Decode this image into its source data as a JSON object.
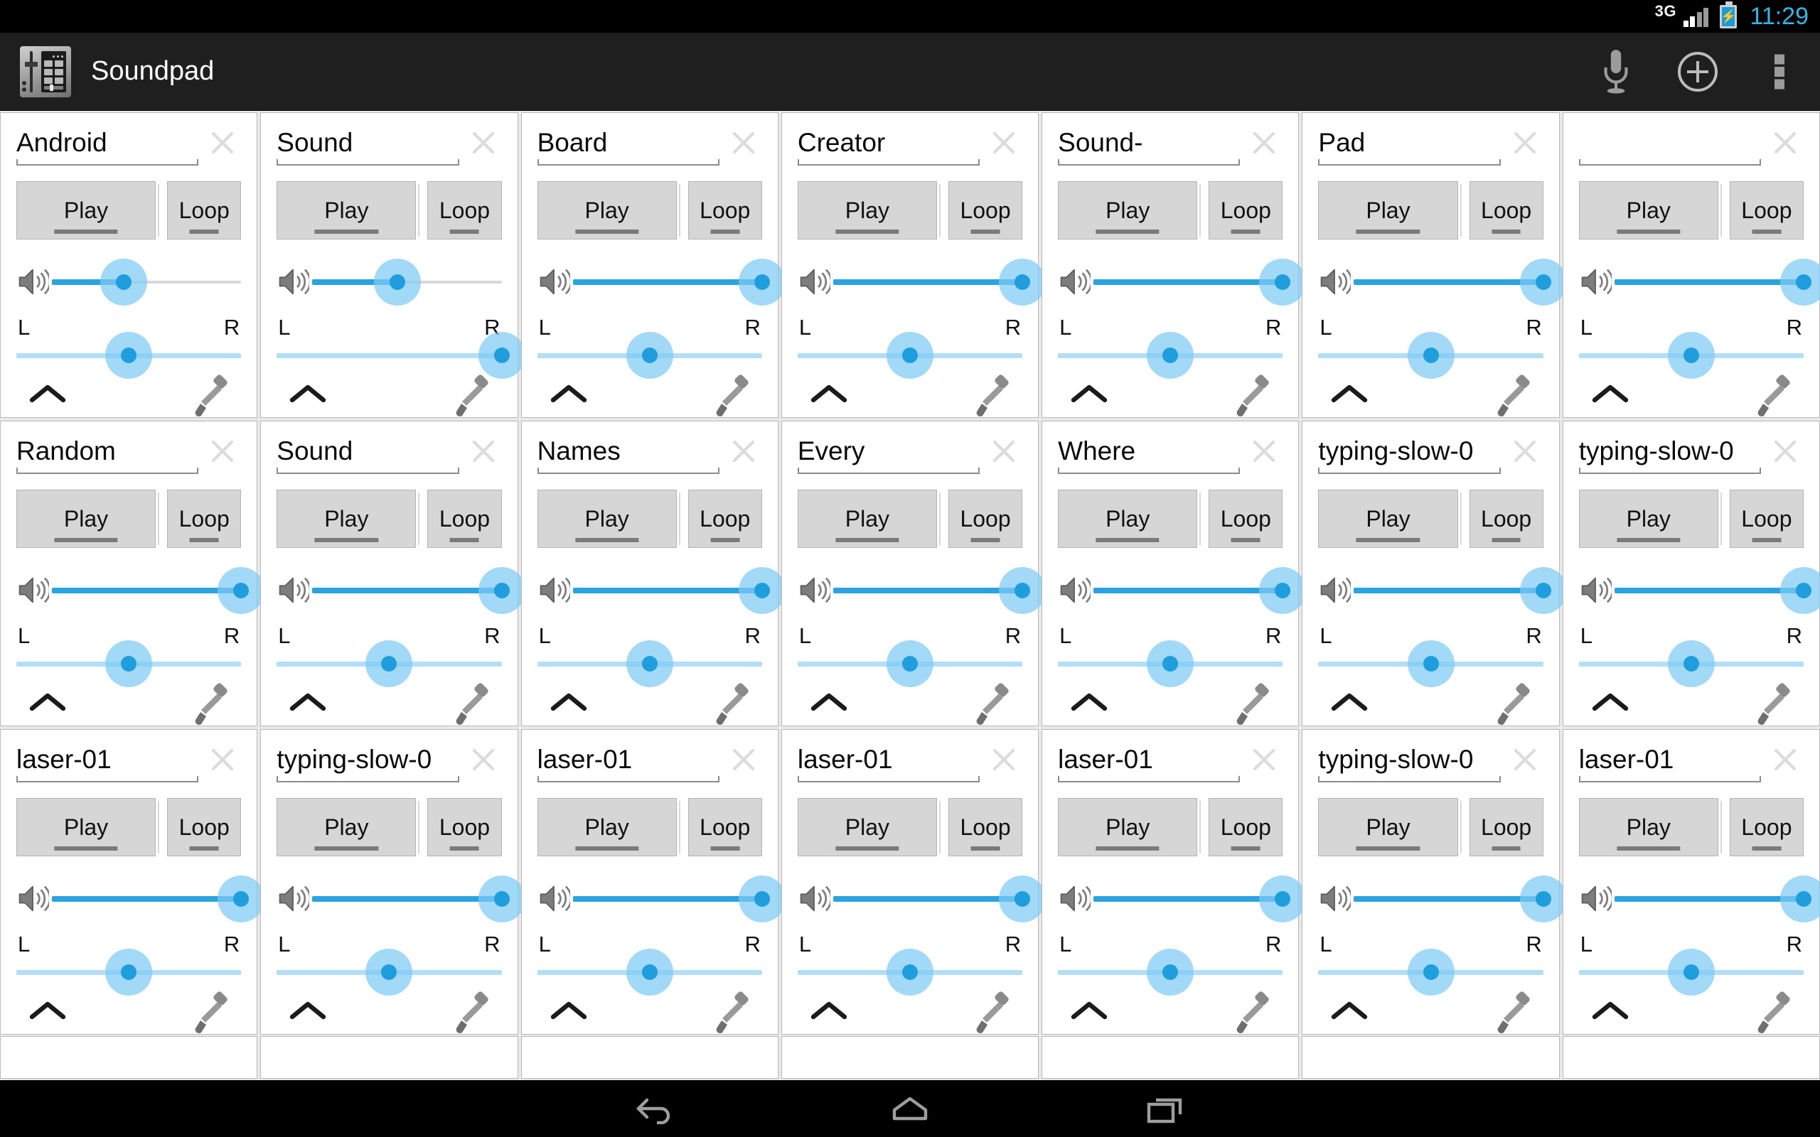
{
  "status_bar": {
    "network_label": "3G",
    "signal_icon": "signal-bars-icon",
    "battery_icon": "battery-charging-icon",
    "clock": "11:29",
    "clock_color": "#33b5e5"
  },
  "action_bar": {
    "logo_icon": "soundpad-app-icon",
    "title": "Soundpad",
    "mic_icon": "microphone-icon",
    "add_icon": "add-circle-icon",
    "overflow_icon": "overflow-menu-icon",
    "background": "#1f1f1f"
  },
  "card_labels": {
    "play": "Play",
    "loop": "Loop",
    "left": "L",
    "right": "R",
    "close_icon": "close-x-icon",
    "speaker_icon": "speaker-volume-icon",
    "collapse_icon": "chevron-up-icon",
    "eyedropper_icon": "eyedropper-icon",
    "title_placeholder": ""
  },
  "accent_colors": {
    "slider_fill": "#2aa3e0",
    "slider_thumb": "#1f9ddd",
    "slider_halo": "#7ecbf2",
    "pan_track": "#b3defa",
    "button_face": "#d6d6d6",
    "page_background": "#e9e9e9"
  },
  "nav_bar": {
    "back_icon": "back-arrow-icon",
    "home_icon": "home-icon",
    "recents_icon": "recent-apps-icon"
  },
  "cards": [
    {
      "title": "Android",
      "volume": 38,
      "pan": 50
    },
    {
      "title": "Sound",
      "volume": 45,
      "pan": 100
    },
    {
      "title": "Board",
      "volume": 100,
      "pan": 50
    },
    {
      "title": "Creator",
      "volume": 100,
      "pan": 50
    },
    {
      "title": "Sound-",
      "volume": 100,
      "pan": 50
    },
    {
      "title": "Pad",
      "volume": 100,
      "pan": 50
    },
    {
      "title": "",
      "volume": 100,
      "pan": 50
    },
    {
      "title": "Random",
      "volume": 100,
      "pan": 50
    },
    {
      "title": "Sound",
      "volume": 100,
      "pan": 50
    },
    {
      "title": "Names",
      "volume": 100,
      "pan": 50
    },
    {
      "title": "Every",
      "volume": 100,
      "pan": 50
    },
    {
      "title": "Where",
      "volume": 100,
      "pan": 50
    },
    {
      "title": "typing-slow-0",
      "volume": 100,
      "pan": 50
    },
    {
      "title": "typing-slow-0",
      "volume": 100,
      "pan": 50
    },
    {
      "title": "laser-01",
      "volume": 100,
      "pan": 50
    },
    {
      "title": "typing-slow-0",
      "volume": 100,
      "pan": 50
    },
    {
      "title": "laser-01",
      "volume": 100,
      "pan": 50
    },
    {
      "title": "laser-01",
      "volume": 100,
      "pan": 50
    },
    {
      "title": "laser-01",
      "volume": 100,
      "pan": 50
    },
    {
      "title": "typing-slow-0",
      "volume": 100,
      "pan": 50
    },
    {
      "title": "laser-01",
      "volume": 100,
      "pan": 50
    }
  ],
  "partial_row_count": 7
}
